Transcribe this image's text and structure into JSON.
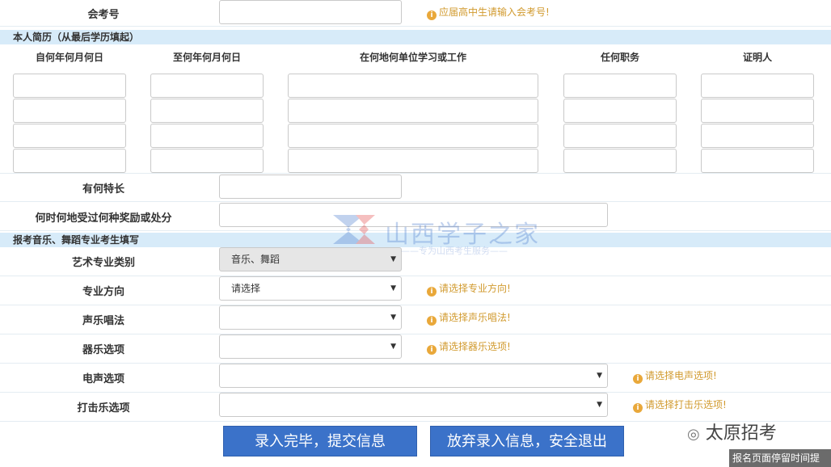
{
  "exam_no": {
    "label": "会考号",
    "hint": "应届高中生请输入会考号!"
  },
  "resume": {
    "section_title": "本人简历（从最后学历填起）",
    "columns": [
      "自何年何月何日",
      "至何年何月何日",
      "在何地何单位学习或工作",
      "任何职务",
      "证明人"
    ]
  },
  "specialty": {
    "label": "有何特长"
  },
  "awards": {
    "label": "何时何地受过何种奖励或处分"
  },
  "art_section": {
    "section_title": "报考音乐、舞蹈专业考生填写"
  },
  "art_category": {
    "label": "艺术专业类别",
    "value": "音乐、舞蹈"
  },
  "major_direction": {
    "label": "专业方向",
    "value": "请选择",
    "hint": "请选择专业方向!"
  },
  "vocal": {
    "label": "声乐唱法",
    "value": "",
    "hint": "请选择声乐唱法!"
  },
  "instrument": {
    "label": "器乐选项",
    "value": "",
    "hint": "请选择器乐选项!"
  },
  "electro": {
    "label": "电声选项",
    "value": "",
    "hint": "请选择电声选项!"
  },
  "percussion": {
    "label": "打击乐选项",
    "value": "",
    "hint": "请选择打击乐选项!"
  },
  "buttons": {
    "submit": "录入完毕，提交信息",
    "exit": "放弃录入信息，安全退出"
  },
  "watermark": {
    "title": "山西学子之家",
    "subtitle": "——专为山西考生服务——"
  },
  "overlay": {
    "account": "太原招考",
    "notice": "报名页面停留时间提"
  },
  "colors": {
    "section_bg": "#d7ebf9",
    "button": "#3b72c9",
    "hint": "#d19a2e"
  }
}
